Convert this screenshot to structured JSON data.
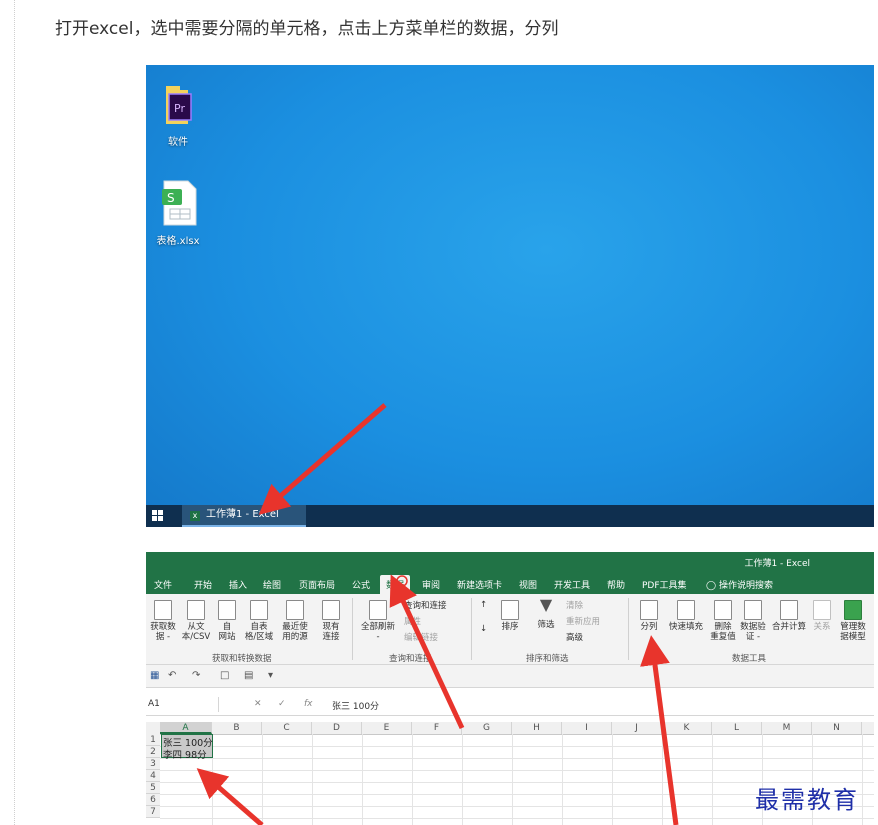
{
  "intro_text": "打开excel，选中需要分隔的单元格，点击上方菜单栏的数据，分列",
  "desktop": {
    "icons": [
      {
        "label": "软件",
        "icon": "premiere-pro-icon"
      },
      {
        "label": "表格.xlsx",
        "icon": "spreadsheet-file-icon"
      }
    ],
    "taskbar_item": "工作薄1 - Excel"
  },
  "excel": {
    "title": "工作薄1 - Excel",
    "tabs": [
      "文件",
      "开始",
      "插入",
      "绘图",
      "页面布局",
      "公式",
      "数据",
      "审阅",
      "新建选项卡",
      "视图",
      "开发工具",
      "帮助",
      "PDF工具集"
    ],
    "active_tab": "数据",
    "tell_me": "操作说明搜索",
    "groups": {
      "get_transform": {
        "name": "获取和转换数据",
        "buttons": [
          [
            "获取数",
            "据 -"
          ],
          [
            "从文",
            "本/CSV"
          ],
          [
            "自",
            "网站"
          ],
          [
            "自表",
            "格/区域"
          ],
          [
            "最近使",
            "用的源"
          ],
          [
            "现有",
            "连接"
          ]
        ]
      },
      "queries": {
        "name": "查询和连接",
        "refresh": [
          "全部刷新",
          "-"
        ],
        "items": [
          "查询和连接",
          "属性",
          "编辑链接"
        ]
      },
      "sort_filter": {
        "name": "排序和筛选",
        "sort": "排序",
        "filter": "筛选",
        "items": [
          "清除",
          "重新应用",
          "高级"
        ]
      },
      "data_tools": {
        "name": "数据工具",
        "buttons": [
          [
            "分列",
            ""
          ],
          [
            "快速填充",
            ""
          ],
          [
            "删除",
            "重复值"
          ],
          [
            "数据验",
            "证 -"
          ],
          [
            "合并计算",
            ""
          ],
          [
            "关系",
            ""
          ],
          [
            "管理数",
            "据模型"
          ]
        ]
      }
    },
    "name_box": "A1",
    "formula": "张三 100分",
    "columns": [
      "A",
      "B",
      "C",
      "D",
      "E",
      "F",
      "G",
      "H",
      "I",
      "J",
      "K",
      "L",
      "M",
      "N"
    ],
    "rows": [
      "1",
      "2",
      "3",
      "4",
      "5",
      "6",
      "7"
    ],
    "cells": [
      "张三 100分",
      "李四 98分"
    ]
  },
  "watermark": "最需教育",
  "colors": {
    "excel_green": "#217346",
    "arrow_red": "#e8342c",
    "desktop_blue": "#1b8fe0"
  }
}
